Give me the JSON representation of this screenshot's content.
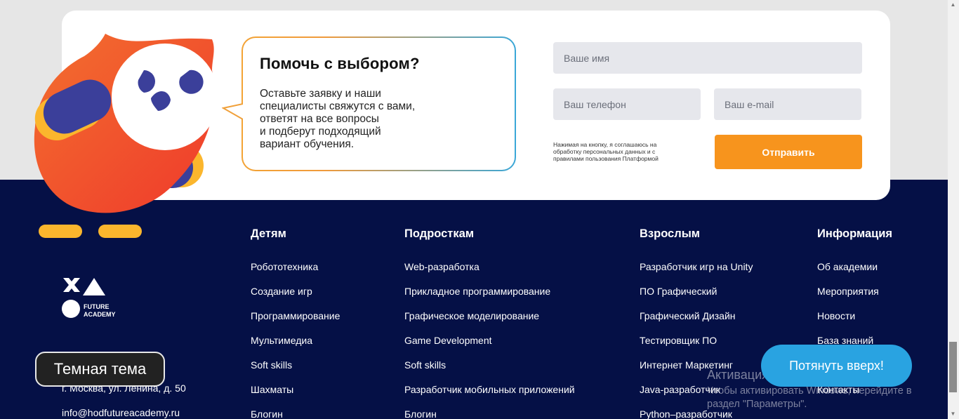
{
  "help_form": {
    "title": "Помочь с выбором?",
    "text_lines": [
      "Оставьте заявку и наши",
      "специалисты свяжутся с вами,",
      "ответят на все вопросы",
      "и подберут подходящий",
      "вариант обучения."
    ],
    "name_placeholder": "Ваше имя",
    "phone_placeholder": "Ваш телефон",
    "email_placeholder": "Ваш e-mail",
    "consent_lines": [
      "Нажимая на кнопку, я соглашаюсь на",
      "обработку персональных данных и с",
      "правилами пользования Платформой"
    ],
    "submit_label": "Отправить"
  },
  "footer": {
    "columns": [
      {
        "title": "Детям",
        "items": [
          "Робототехника",
          "Создание игр",
          "Программирование",
          "Мультимедиа",
          "Soft skills",
          "Шахматы",
          "Блогин"
        ]
      },
      {
        "title": "Подросткам",
        "items": [
          "Web-разработка",
          "Прикладное программирование",
          "Графическое моделирование",
          "Game Development",
          "Soft skills",
          "Разработчик мобильных приложений",
          "Блогин"
        ]
      },
      {
        "title": "Взрослым",
        "items": [
          "Разработчик игр на Unity",
          "ПО Графический",
          "Графический Дизайн",
          "Тестировщик ПО",
          "Интернет Маркетинг",
          "Java-разработчик",
          "Python–разработчик"
        ]
      },
      {
        "title": "Информация",
        "items": [
          "Об академии",
          "Мероприятия",
          "Новости",
          "База знаний",
          "Контакты"
        ]
      }
    ],
    "logo_text_1": "FUTURE",
    "logo_text_2": "ACADEMY",
    "address": "г. Москва, ул. Ленина, д. 50",
    "email": "info@hodfutureacademy.ru"
  },
  "theme_button": "Темная тема",
  "scroll_up_button": "Потянуть вверх!",
  "windows_watermark": {
    "title": "Активация Windows",
    "line1": "Чтобы активировать Windows, перейдите в",
    "line2": "раздел \"Параметры\"."
  },
  "colors": {
    "accent_orange": "#f7941d",
    "footer_bg": "#051046",
    "scroll_button": "#29a3e1"
  }
}
